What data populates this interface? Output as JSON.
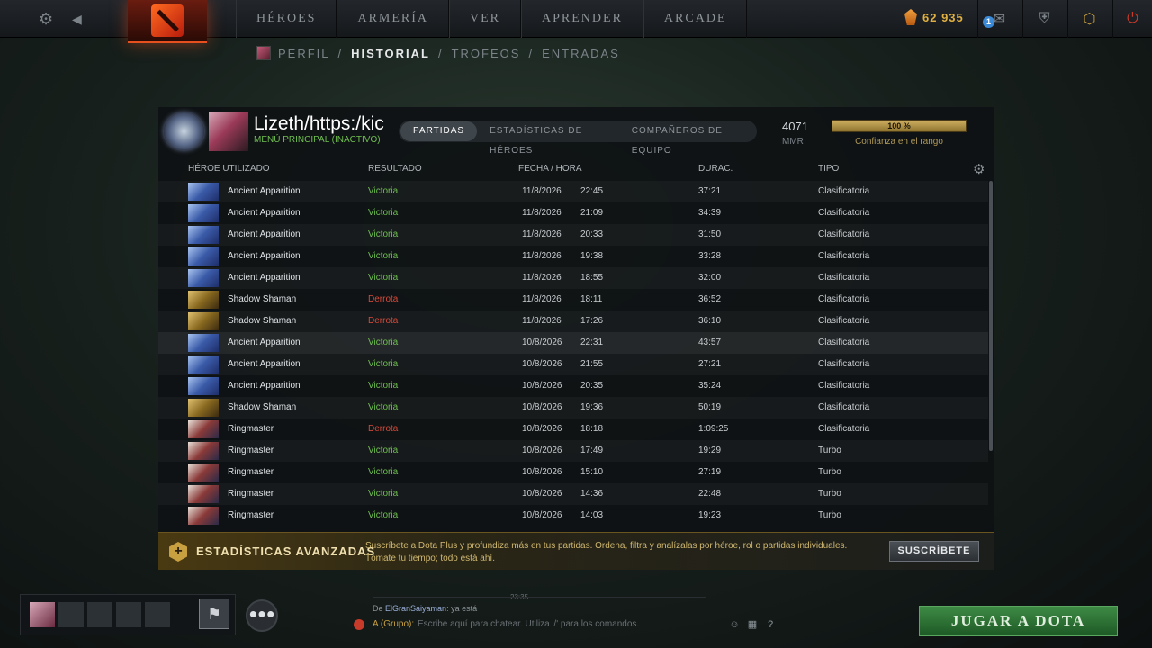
{
  "topbar": {
    "nav": [
      "HÉROES",
      "ARMERÍA",
      "VER",
      "APRENDER",
      "ARCADE"
    ],
    "shards": "62 935",
    "notif_count": "1"
  },
  "subnav": {
    "items": [
      "PERFIL",
      "HISTORIAL",
      "TROFEOS",
      "ENTRADAS"
    ],
    "separator": "/"
  },
  "profile": {
    "name": "Lizeth/https:/kic",
    "status": "MENÚ PRINCIPAL (INACTIVO)",
    "tabs": [
      "PARTIDAS",
      "ESTADÍSTICAS DE HÉROES",
      "COMPAÑEROS DE EQUIPO"
    ],
    "mmr": "4071",
    "mmr_label": "MMR",
    "confidence": "100 %",
    "confidence_fraction": 1.0,
    "confidence_label": "Confianza en el rango"
  },
  "table": {
    "headers": [
      "HÉROE UTILIZADO",
      "RESULTADO",
      "FECHA / HORA",
      "DURAC.",
      "TIPO"
    ],
    "rows": [
      {
        "hero": "Ancient Apparition",
        "result": "Victoria",
        "date": "11/8/2026",
        "time": "22:45",
        "duration": "37:21",
        "type": "Clasificatoria"
      },
      {
        "hero": "Ancient Apparition",
        "result": "Victoria",
        "date": "11/8/2026",
        "time": "21:09",
        "duration": "34:39",
        "type": "Clasificatoria"
      },
      {
        "hero": "Ancient Apparition",
        "result": "Victoria",
        "date": "11/8/2026",
        "time": "20:33",
        "duration": "31:50",
        "type": "Clasificatoria"
      },
      {
        "hero": "Ancient Apparition",
        "result": "Victoria",
        "date": "11/8/2026",
        "time": "19:38",
        "duration": "33:28",
        "type": "Clasificatoria"
      },
      {
        "hero": "Ancient Apparition",
        "result": "Victoria",
        "date": "11/8/2026",
        "time": "18:55",
        "duration": "32:00",
        "type": "Clasificatoria"
      },
      {
        "hero": "Shadow Shaman",
        "result": "Derrota",
        "date": "11/8/2026",
        "time": "18:11",
        "duration": "36:52",
        "type": "Clasificatoria"
      },
      {
        "hero": "Shadow Shaman",
        "result": "Derrota",
        "date": "11/8/2026",
        "time": "17:26",
        "duration": "36:10",
        "type": "Clasificatoria"
      },
      {
        "hero": "Ancient Apparition",
        "result": "Victoria",
        "date": "10/8/2026",
        "time": "22:31",
        "duration": "43:57",
        "type": "Clasificatoria"
      },
      {
        "hero": "Ancient Apparition",
        "result": "Victoria",
        "date": "10/8/2026",
        "time": "21:55",
        "duration": "27:21",
        "type": "Clasificatoria"
      },
      {
        "hero": "Ancient Apparition",
        "result": "Victoria",
        "date": "10/8/2026",
        "time": "20:35",
        "duration": "35:24",
        "type": "Clasificatoria"
      },
      {
        "hero": "Shadow Shaman",
        "result": "Victoria",
        "date": "10/8/2026",
        "time": "19:36",
        "duration": "50:19",
        "type": "Clasificatoria"
      },
      {
        "hero": "Ringmaster",
        "result": "Derrota",
        "date": "10/8/2026",
        "time": "18:18",
        "duration": "1:09:25",
        "type": "Clasificatoria"
      },
      {
        "hero": "Ringmaster",
        "result": "Victoria",
        "date": "10/8/2026",
        "time": "17:49",
        "duration": "19:29",
        "type": "Turbo"
      },
      {
        "hero": "Ringmaster",
        "result": "Victoria",
        "date": "10/8/2026",
        "time": "15:10",
        "duration": "27:19",
        "type": "Turbo"
      },
      {
        "hero": "Ringmaster",
        "result": "Victoria",
        "date": "10/8/2026",
        "time": "14:36",
        "duration": "22:48",
        "type": "Turbo"
      },
      {
        "hero": "Ringmaster",
        "result": "Victoria",
        "date": "10/8/2026",
        "time": "14:03",
        "duration": "19:23",
        "type": "Turbo"
      }
    ]
  },
  "plus": {
    "title": "ESTADÍSTICAS AVANZADAS",
    "desc1": "Suscríbete a Dota Plus y profundiza más en tus partidas. Ordena, filtra y analízalas por héroe, rol o partidas individuales.",
    "desc2": "Tómate tu tiempo; todo está ahí.",
    "button": "SUSCRÍBETE"
  },
  "chat": {
    "timestamp": "23:35",
    "from_prefix": "De",
    "from_name": "ElGranSaiyaman",
    "message": ": ya está",
    "channel": "A (Grupo):",
    "placeholder": "Escribe aquí para chatear. Utiliza '/' para los comandos."
  },
  "play_button": "JUGAR A DOTA"
}
